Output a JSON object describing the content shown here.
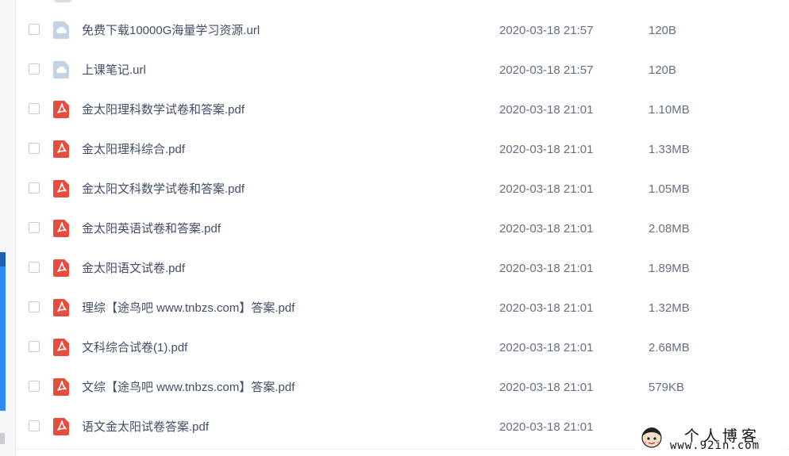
{
  "colors": {
    "pdf_icon": "#e84c3d",
    "cloud_icon": "#c3d3e4",
    "accent": "#2f8bf0"
  },
  "files": [
    {
      "icon": "url-cloud-icon",
      "name": "免费下载10000G海量学习资源.url",
      "date": "2020-03-18 21:57",
      "size": "120B"
    },
    {
      "icon": "url-cloud-icon",
      "name": "上课笔记.url",
      "date": "2020-03-18 21:57",
      "size": "120B"
    },
    {
      "icon": "pdf-icon",
      "name": "金太阳理科数学试卷和答案.pdf",
      "date": "2020-03-18 21:01",
      "size": "1.10MB"
    },
    {
      "icon": "pdf-icon",
      "name": "金太阳理科综合.pdf",
      "date": "2020-03-18 21:01",
      "size": "1.33MB"
    },
    {
      "icon": "pdf-icon",
      "name": "金太阳文科数学试卷和答案.pdf",
      "date": "2020-03-18 21:01",
      "size": "1.05MB"
    },
    {
      "icon": "pdf-icon",
      "name": "金太阳英语试卷和答案.pdf",
      "date": "2020-03-18 21:01",
      "size": "2.08MB"
    },
    {
      "icon": "pdf-icon",
      "name": "金太阳语文试卷.pdf",
      "date": "2020-03-18 21:01",
      "size": "1.89MB"
    },
    {
      "icon": "pdf-icon",
      "name": "理综【途鸟吧 www.tnbzs.com】答案.pdf",
      "date": "2020-03-18 21:01",
      "size": "1.32MB"
    },
    {
      "icon": "pdf-icon",
      "name": "文科综合试卷(1).pdf",
      "date": "2020-03-18 21:01",
      "size": "2.68MB"
    },
    {
      "icon": "pdf-icon",
      "name": "文综【途鸟吧 www.tnbzs.com】答案.pdf",
      "date": "2020-03-18 21:01",
      "size": "579KB"
    },
    {
      "icon": "pdf-icon",
      "name": "语文金太阳试卷答案.pdf",
      "date": "2020-03-18 21:01",
      "size": ""
    }
  ],
  "watermark": {
    "title": "个人博客",
    "url": "www.92in.com"
  }
}
